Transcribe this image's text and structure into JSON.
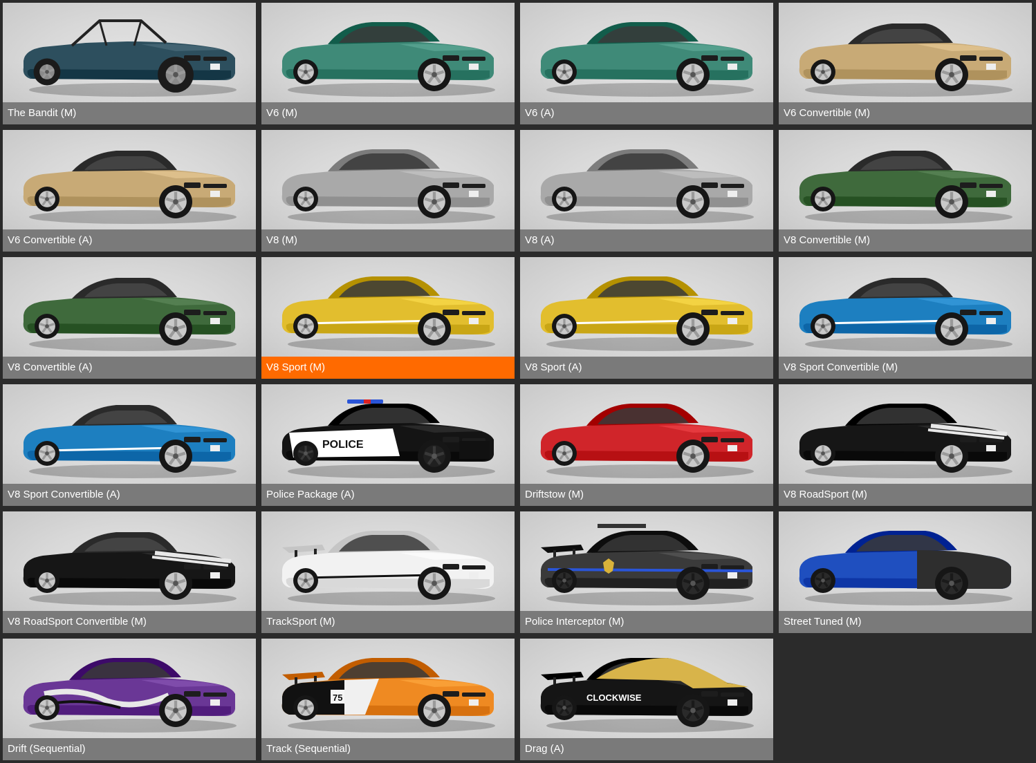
{
  "selection": {
    "selected_index": 9,
    "selected_color": "#ff6a00",
    "label_bg": "#7a7a7a"
  },
  "variants": [
    {
      "name": "The Bandit (M)",
      "body": "#2d4f5e",
      "roof": "cage",
      "wheel": "offroad"
    },
    {
      "name": "V6 (M)",
      "body": "#3f8a78",
      "roof": "hard",
      "wheel": "std"
    },
    {
      "name": "V6 (A)",
      "body": "#3f8a78",
      "roof": "hard",
      "wheel": "std"
    },
    {
      "name": "V6 Convertible (M)",
      "body": "#c8aa76",
      "roof": "soft",
      "wheel": "std"
    },
    {
      "name": "V6 Convertible (A)",
      "body": "#c8aa76",
      "roof": "soft",
      "wheel": "std"
    },
    {
      "name": "V8 (M)",
      "body": "#a9a9a9",
      "roof": "hard",
      "wheel": "std"
    },
    {
      "name": "V8 (A)",
      "body": "#a9a9a9",
      "roof": "hard",
      "wheel": "std"
    },
    {
      "name": "V8 Convertible (M)",
      "body": "#3f6a3c",
      "roof": "soft",
      "wheel": "std"
    },
    {
      "name": "V8 Convertible (A)",
      "body": "#3f6a3c",
      "roof": "soft",
      "wheel": "std"
    },
    {
      "name": "V8 Sport (M)",
      "body": "#e2be2e",
      "roof": "hard",
      "wheel": "std",
      "stripe": "side"
    },
    {
      "name": "V8 Sport (A)",
      "body": "#e2be2e",
      "roof": "hard",
      "wheel": "std",
      "stripe": "side"
    },
    {
      "name": "V8 Sport Convertible (M)",
      "body": "#1d7fc0",
      "roof": "soft",
      "wheel": "std",
      "stripe": "side"
    },
    {
      "name": "V8 Sport Convertible (A)",
      "body": "#1d7fc0",
      "roof": "soft",
      "wheel": "std",
      "stripe": "side"
    },
    {
      "name": "Police Package (A)",
      "body": "#141414",
      "roof": "hard",
      "wheel": "steel",
      "livery": "police"
    },
    {
      "name": "Driftstow (M)",
      "body": "#d0252a",
      "roof": "hard",
      "wheel": "std"
    },
    {
      "name": "V8 RoadSport (M)",
      "body": "#161616",
      "roof": "hard",
      "wheel": "std",
      "stripe": "racing"
    },
    {
      "name": "V8 RoadSport Convertible (M)",
      "body": "#161616",
      "roof": "soft",
      "wheel": "std",
      "stripe": "racing"
    },
    {
      "name": "TrackSport (M)",
      "body": "#f2f2f2",
      "roof": "hard",
      "wheel": "std",
      "stripe": "side",
      "wing": true
    },
    {
      "name": "Police Interceptor (M)",
      "body": "#3a3a3a",
      "roof": "hard",
      "wheel": "black",
      "livery": "interceptor",
      "wing": true
    },
    {
      "name": "Street Tuned (M)",
      "body": "#1f4fbf",
      "roof": "hard",
      "wheel": "black",
      "livery": "split"
    },
    {
      "name": "Drift (Sequential)",
      "body": "#6a3796",
      "roof": "hard",
      "wheel": "std",
      "livery": "drift"
    },
    {
      "name": "Track (Sequential)",
      "body": "#ef8a22",
      "roof": "hard",
      "wheel": "std",
      "livery": "track",
      "wing": true
    },
    {
      "name": "Drag (A)",
      "body": "#151515",
      "roof": "hard",
      "wheel": "black",
      "livery": "drag",
      "wing": true
    }
  ],
  "livery_text": {
    "police": "POLICE",
    "track_number": "75",
    "drag": "CLOCKWISE"
  }
}
